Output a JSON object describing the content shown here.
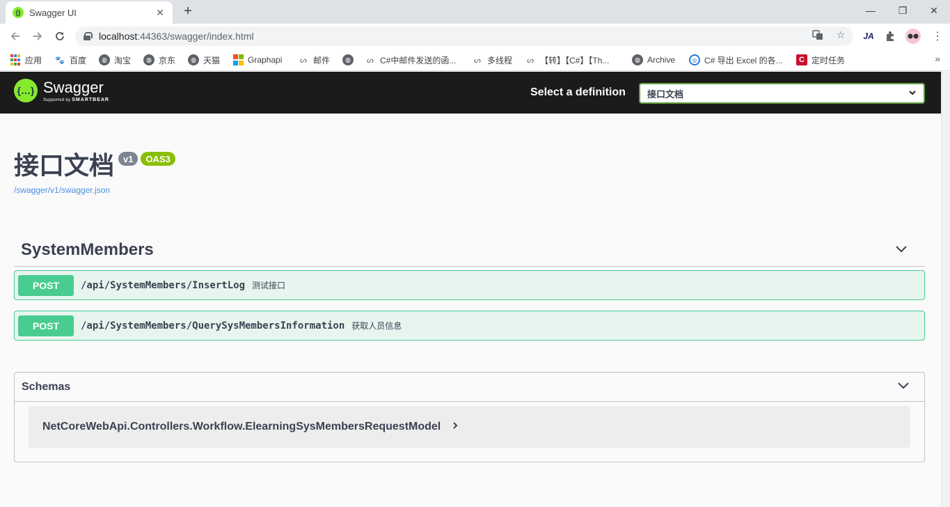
{
  "browser": {
    "tab_title": "Swagger UI",
    "tab_close": "✕",
    "new_tab": "+",
    "url_host": "localhost",
    "url_rest": ":44363/swagger/index.html",
    "window_controls": [
      "—",
      "❐",
      "✕"
    ],
    "bookmarks": [
      {
        "label": "应用",
        "icon": "apps-grid-icon"
      },
      {
        "label": "百度",
        "icon": "baidu-paw-icon"
      },
      {
        "label": "淘宝",
        "icon": "globe-icon"
      },
      {
        "label": "京东",
        "icon": "globe-icon"
      },
      {
        "label": "天猫",
        "icon": "globe-icon"
      },
      {
        "label": "Graphapi",
        "icon": "microsoft-icon"
      },
      {
        "label": "邮件",
        "icon": "swirl-icon"
      },
      {
        "label": "",
        "icon": "globe-icon"
      },
      {
        "label": "C#中邮件发送的函...",
        "icon": "swirl-icon"
      },
      {
        "label": "多线程",
        "icon": "swirl-icon"
      },
      {
        "label": "【转】【C#】【Th...",
        "icon": "swirl-icon"
      },
      {
        "label": "Archive",
        "icon": "globe-icon"
      },
      {
        "label": "C# 导出 Excel 的各...",
        "icon": "blue-circle-icon"
      },
      {
        "label": "定时任务",
        "icon": "red-c-icon"
      }
    ],
    "bookmarks_more": "»"
  },
  "topbar": {
    "logo_name": "Swagger",
    "logo_sub_prefix": "Supported by",
    "logo_sub_brand": "SMARTBEAR",
    "definition_label": "Select a definition",
    "definition_value": "接口文档"
  },
  "info": {
    "title": "接口文档",
    "version": "v1",
    "oas": "OAS3",
    "spec_link": "/swagger/v1/swagger.json"
  },
  "tag": {
    "name": "SystemMembers",
    "operations": [
      {
        "method": "POST",
        "path": "/api/SystemMembers/InsertLog",
        "summary": "测试接口"
      },
      {
        "method": "POST",
        "path": "/api/SystemMembers/QuerySysMembersInformation",
        "summary": "获取人员信息"
      }
    ]
  },
  "schemas": {
    "title": "Schemas",
    "models": [
      "NetCoreWebApi.Controllers.Workflow.ElearningSysMembersRequestModel"
    ]
  },
  "colors": {
    "post": "#49cc90",
    "topbar": "#1b1b1b",
    "swagger_green": "#85ea2d",
    "link": "#4990e2"
  }
}
